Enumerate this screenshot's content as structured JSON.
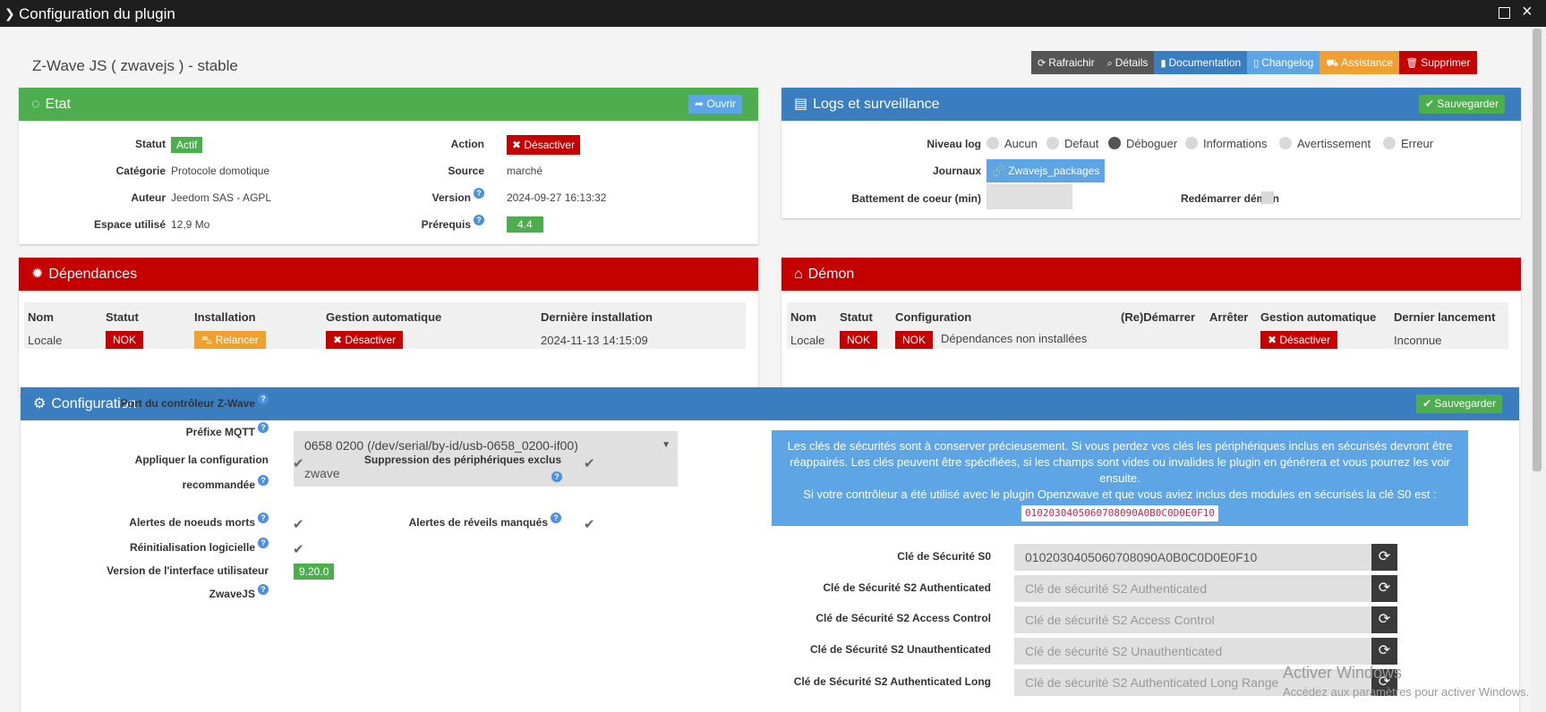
{
  "window": {
    "title": "Configuration du plugin"
  },
  "plugin_title": "Z-Wave JS ( zwavejs ) - stable",
  "toolbar": {
    "refresh": "Rafraichir",
    "details": "Détails",
    "documentation": "Documentation",
    "changelog": "Changelog",
    "assistance": "Assistance",
    "delete": "Supprimer"
  },
  "etat": {
    "title": "Etat",
    "open_button": "Ouvrir",
    "statut_label": "Statut",
    "statut_value": "Actif",
    "categorie_label": "Catégorie",
    "categorie_value": "Protocole domotique",
    "auteur_label": "Auteur",
    "auteur_value": "Jeedom SAS",
    "licence_value": "- AGPL",
    "espace_label": "Espace utilisé",
    "espace_value": "12,9 Mo",
    "action_label": "Action",
    "action_button": "Désactiver",
    "source_label": "Source",
    "source_value": "marché",
    "version_label": "Version",
    "version_value": "2024-09-27 16:13:32",
    "prerequis_label": "Prérequis",
    "prerequis_value": "4.4"
  },
  "logs": {
    "title": "Logs et surveillance",
    "save_button": "Sauvegarder",
    "niveau_label": "Niveau log",
    "levels": [
      "Aucun",
      "Defaut",
      "Déboguer",
      "Informations",
      "Avertissement",
      "Erreur"
    ],
    "selected_level": "Déboguer",
    "journaux_label": "Journaux",
    "journal_button": "Zwavejs_packages",
    "heartbeat_label": "Battement de coeur (min)",
    "heartbeat_value": "",
    "restart_label": "Redémarrer démon"
  },
  "dependances": {
    "title": "Dépendances",
    "headers": [
      "Nom",
      "Statut",
      "Installation",
      "Gestion automatique",
      "Dernière installation"
    ],
    "row": {
      "nom": "Locale",
      "statut": "NOK",
      "installation": "Relancer",
      "gestion": "Désactiver",
      "derniere": "2024-11-13 14:15:09"
    }
  },
  "demon": {
    "title": "Démon",
    "headers": [
      "Nom",
      "Statut",
      "Configuration",
      "(Re)Démarrer",
      "Arrêter",
      "Gestion automatique",
      "Dernier lancement"
    ],
    "row": {
      "nom": "Locale",
      "statut": "NOK",
      "config_status": "NOK",
      "config_text": "Dépendances non installées",
      "gestion": "Désactiver",
      "dernier": "Inconnue"
    }
  },
  "configuration": {
    "title": "Configuration",
    "save_button": "Sauvegarder",
    "port_label": "Port du contrôleur Z-Wave",
    "port_value": "0658 0200 (/dev/serial/by-id/usb-0658_0200-if00)",
    "mqtt_label": "Préfixe MQTT",
    "mqtt_value": "zwave",
    "apply_label_1": "Appliquer la configuration",
    "apply_label_2": "recommandée",
    "suppression_label": "Suppression des périphériques exclus",
    "dead_label": "Alertes de noeuds morts",
    "wake_label": "Alertes de réveils manqués",
    "soft_reset_label": "Réinitialisation logicielle",
    "ui_version_label_1": "Version de l'interface utilisateur",
    "ui_version_label_2": "ZwaveJS",
    "ui_version_value": "9.20.0",
    "info_line1": "Les clés de sécurités sont à conserver précieusement. Si vous perdez vos clés les périphériques inclus en sécurisés devront être",
    "info_line2": "réappairés. Les clés peuvent être spécifiées, si les champs sont vides ou invalides le plugin en générera et vous pourrez les voir",
    "info_line3": "ensuite.",
    "info_line4": "Si votre contrôleur a été utilisé avec le plugin Openzwave et que vous aviez inclus des modules en sécurisés la clé S0 est :",
    "info_code": "0102030405060708090A0B0C0D0E0F10",
    "s0_label": "Clé de Sécurité S0",
    "s0_value": "0102030405060708090A0B0C0D0E0F10",
    "s2auth_label": "Clé de Sécurité S2 Authenticated",
    "s2auth_placeholder": "Clé de sécurité S2 Authenticated",
    "s2ac_label": "Clé de Sécurité S2 Access Control",
    "s2ac_placeholder": "Clé de sécurité S2 Access Control",
    "s2unauth_label": "Clé de Sécurité S2 Unauthenticated",
    "s2unauth_placeholder": "Clé de sécurité S2 Unauthenticated",
    "s2long_label": "Clé de Sécurité S2 Authenticated Long",
    "s2long_placeholder": "Clé de sécurité S2 Authenticated Long Range"
  },
  "watermark": {
    "line1": "Activer Windows",
    "line2": "Accédez aux paramètres pour activer Windows."
  },
  "colors": {
    "green": "#4cae4c",
    "blue": "#3a7ebf",
    "red": "#c40000",
    "orange": "#f0a030",
    "light_blue": "#5ea5e6"
  }
}
